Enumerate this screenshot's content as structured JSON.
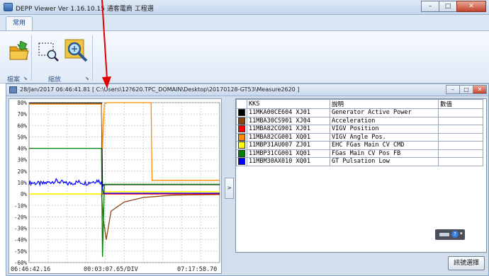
{
  "window": {
    "title": "DEPP Viewer Ver 1.16.10.15 通客電商 工程選",
    "minimize": "–",
    "maximize": "□",
    "close": "✕"
  },
  "ribbon": {
    "tab_label": "常用",
    "group_file_label": "檔案",
    "group_zoom_label": "縮放",
    "icons": [
      "open-folder-icon",
      "zoom-select-icon",
      "zoom-fit-icon"
    ]
  },
  "measure_window": {
    "title": "28/Jan/2017 06:46:41.81  [ C:\\Users\\12?620.TPC_DOMAIN\\Desktop\\20170128-GT53\\Measure2620 ]",
    "expand_button": ">",
    "confirm_button": "訊號選擇"
  },
  "chart_data": {
    "type": "line",
    "y_ticks": [
      "80%",
      "70%",
      "60%",
      "50%",
      "40%",
      "30%",
      "20%",
      "10%",
      "0%",
      "-10%",
      "-20%",
      "-30%",
      "-40%",
      "-50%",
      "-60%"
    ],
    "ylim": [
      -60,
      80
    ],
    "time_labels": {
      "start": "06:46:42.16",
      "div": "00:03:07.65/DIV",
      "end": "07:17:58.70"
    },
    "grid": true,
    "series": [
      {
        "color": "#000000",
        "x": [
          0,
          0.38,
          0.385,
          0.39,
          1.0
        ],
        "y": [
          79.6,
          79.6,
          6,
          8.2,
          8.2
        ]
      },
      {
        "color": "#8b4513",
        "x": [
          0,
          0.38,
          0.39,
          0.405,
          0.43,
          0.5,
          0.6,
          0.75,
          1.0
        ],
        "y": [
          0,
          0,
          -22,
          -40,
          -15,
          -7,
          -3,
          -1,
          -0.5
        ]
      },
      {
        "color": "#ff0000",
        "x": [
          0,
          1.0
        ],
        "y": [
          0,
          0
        ]
      },
      {
        "color": "#ff8c00",
        "x": [
          0,
          0.38,
          0.385,
          0.395,
          0.41,
          0.64,
          0.645,
          1.0
        ],
        "y": [
          78.7,
          78.7,
          40,
          78.7,
          80,
          80,
          12,
          12
        ]
      },
      {
        "color": "#ffff00",
        "x": [
          0,
          0.38,
          0.385,
          1.0
        ],
        "y": [
          0,
          0,
          2,
          2
        ]
      },
      {
        "color": "#008000",
        "x": [
          0,
          0.38,
          0.385,
          0.395,
          1.0
        ],
        "y": [
          40,
          40,
          -55,
          8.5,
          8.5
        ]
      },
      {
        "color": "#0000ff",
        "x": [
          0,
          0.07,
          0.14,
          0.2,
          0.26,
          0.3,
          0.34,
          0.36,
          0.38,
          0.39,
          0.5,
          1.0
        ],
        "y": [
          10,
          9,
          11.5,
          9,
          10.5,
          9.5,
          11,
          12,
          10,
          0.7,
          0.7,
          0.7
        ]
      }
    ]
  },
  "table": {
    "headers": [
      "KKS",
      "說明",
      "數值"
    ],
    "rows": [
      {
        "color": "#000000",
        "kks": "11MKA00CE604 XJ01",
        "desc": "Generator Active Power",
        "value": ""
      },
      {
        "color": "#8b4513",
        "kks": "11MBA30CS901 XJ04",
        "desc": "Acceleration",
        "value": ""
      },
      {
        "color": "#ff0000",
        "kks": "11MBA82CG901 XJ01",
        "desc": "VIGV Position",
        "value": ""
      },
      {
        "color": "#ff8c00",
        "kks": "11MBA82CG001 XQ01",
        "desc": "VIGV Angle Pos.",
        "value": ""
      },
      {
        "color": "#ffff00",
        "kks": "11MBP31AU007 ZJ01",
        "desc": "EHC FGas Main CV CMD",
        "value": ""
      },
      {
        "color": "#008000",
        "kks": "11MBP31CG001 XQ01",
        "desc": "FGas Main CV Pos FB",
        "value": ""
      },
      {
        "color": "#0000ff",
        "kks": "11MBM30AX010 XQ01",
        "desc": "GT Pulsation Low",
        "value": ""
      }
    ]
  }
}
